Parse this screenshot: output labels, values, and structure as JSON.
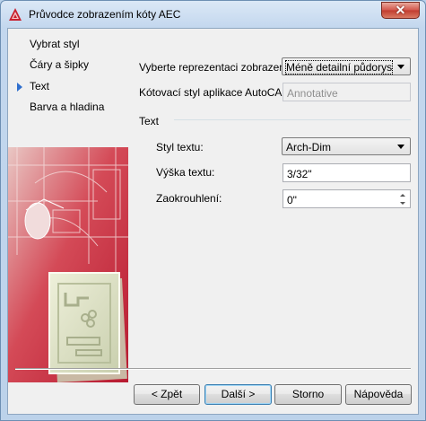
{
  "window": {
    "title": "Průvodce zobrazením kóty AEC",
    "close_glyph": "✕"
  },
  "nav": {
    "items": [
      {
        "label": "Vybrat styl",
        "active": false
      },
      {
        "label": "Čáry a šipky",
        "active": false
      },
      {
        "label": "Text",
        "active": true
      },
      {
        "label": "Barva a hladina",
        "active": false
      }
    ]
  },
  "form": {
    "representation_label": "Vyberte reprezentaci zobrazení:",
    "representation_value": "Méně detailní půdorys",
    "autocad_style_label": "Kótovací styl aplikace AutoCAD:",
    "autocad_style_value": "Annotative",
    "group_title": "Text",
    "text_style_label": "Styl textu:",
    "text_style_value": "Arch-Dim",
    "text_height_label": "Výška textu:",
    "text_height_value": "3/32\"",
    "rounding_label": "Zaokrouhlení:",
    "rounding_value": "0\""
  },
  "buttons": {
    "back": "< Zpět",
    "next": "Další >",
    "cancel": "Storno",
    "help": "Nápověda"
  },
  "colors": {
    "accent_nav_arrow": "#2f6fce",
    "illustration_red": "#c8283a",
    "illustration_cream": "#dfe3c6"
  },
  "icons": {
    "app": "autocad-a-logo",
    "close": "close-icon",
    "active_step": "play-arrow-icon"
  }
}
